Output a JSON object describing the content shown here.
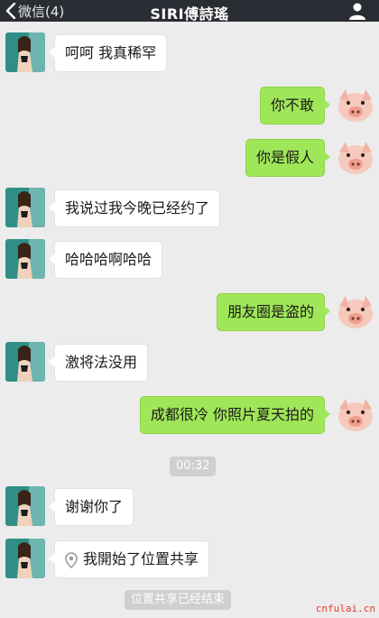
{
  "header": {
    "back_label": "微信(4)",
    "title": "SIRI傅詩瑤",
    "profile_icon": "person-icon"
  },
  "messages": [
    {
      "side": "in",
      "text": "呵呵 我真稀罕"
    },
    {
      "side": "out",
      "text": "你不敢"
    },
    {
      "side": "out",
      "text": "你是假人"
    },
    {
      "side": "in",
      "text": "我说过我今晚已经约了"
    },
    {
      "side": "in",
      "text": "哈哈哈啊哈哈"
    },
    {
      "side": "out",
      "text": "朋友圈是盗的"
    },
    {
      "side": "in",
      "text": "激将法没用"
    },
    {
      "side": "out",
      "text": "成都很冷 你照片夏天拍的"
    },
    {
      "side": "in",
      "text": "谢谢你了"
    },
    {
      "side": "in",
      "text": "我開始了位置共享",
      "icon": "location-pin-icon"
    }
  ],
  "timestamp": "00:32",
  "system_notice": "位置共享已经结束",
  "watermark": "cnfulai.cn",
  "colors": {
    "header_bg": "#2a2d33",
    "chat_bg": "#ececec",
    "outgoing_bubble": "#9fe658",
    "incoming_bubble": "#ffffff",
    "pill_bg": "#cfcfcf",
    "watermark": "#e23a2f"
  }
}
